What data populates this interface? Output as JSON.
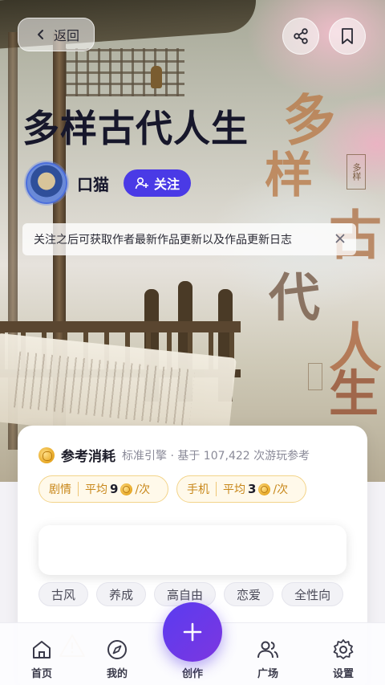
{
  "header": {
    "back_label": "返回"
  },
  "work": {
    "title": "多样古代人生"
  },
  "hero_art": {
    "calligraphy": [
      "多",
      "样",
      "古",
      "代",
      "人",
      "生"
    ],
    "seal_text": "多样"
  },
  "author": {
    "name": "口猫",
    "follow_label": "关注"
  },
  "notice": {
    "text": "关注之后可获取作者最新作品更新以及作品更新日志"
  },
  "cost": {
    "title": "参考消耗",
    "subtitle": "标准引擎 · 基于 107,422 次游玩参考",
    "pills": [
      {
        "label": "剧情",
        "avg_label": "平均",
        "value": "9",
        "unit": "/次"
      },
      {
        "label": "手机",
        "avg_label": "平均",
        "value": "3",
        "unit": "/次"
      }
    ]
  },
  "tags": [
    "古风",
    "养成",
    "高自由",
    "恋爱",
    "全性向"
  ],
  "bottom_nav": {
    "items": [
      {
        "label": "首页",
        "icon": "home-icon"
      },
      {
        "label": "我的",
        "icon": "compass-icon"
      },
      {
        "label": "创作",
        "icon": "plus-icon"
      },
      {
        "label": "广场",
        "icon": "users-icon"
      },
      {
        "label": "设置",
        "icon": "gear-icon"
      }
    ]
  },
  "colors": {
    "accent": "#4a3ae6",
    "coin": "#e7a722",
    "pill_border": "#f3d48a"
  }
}
